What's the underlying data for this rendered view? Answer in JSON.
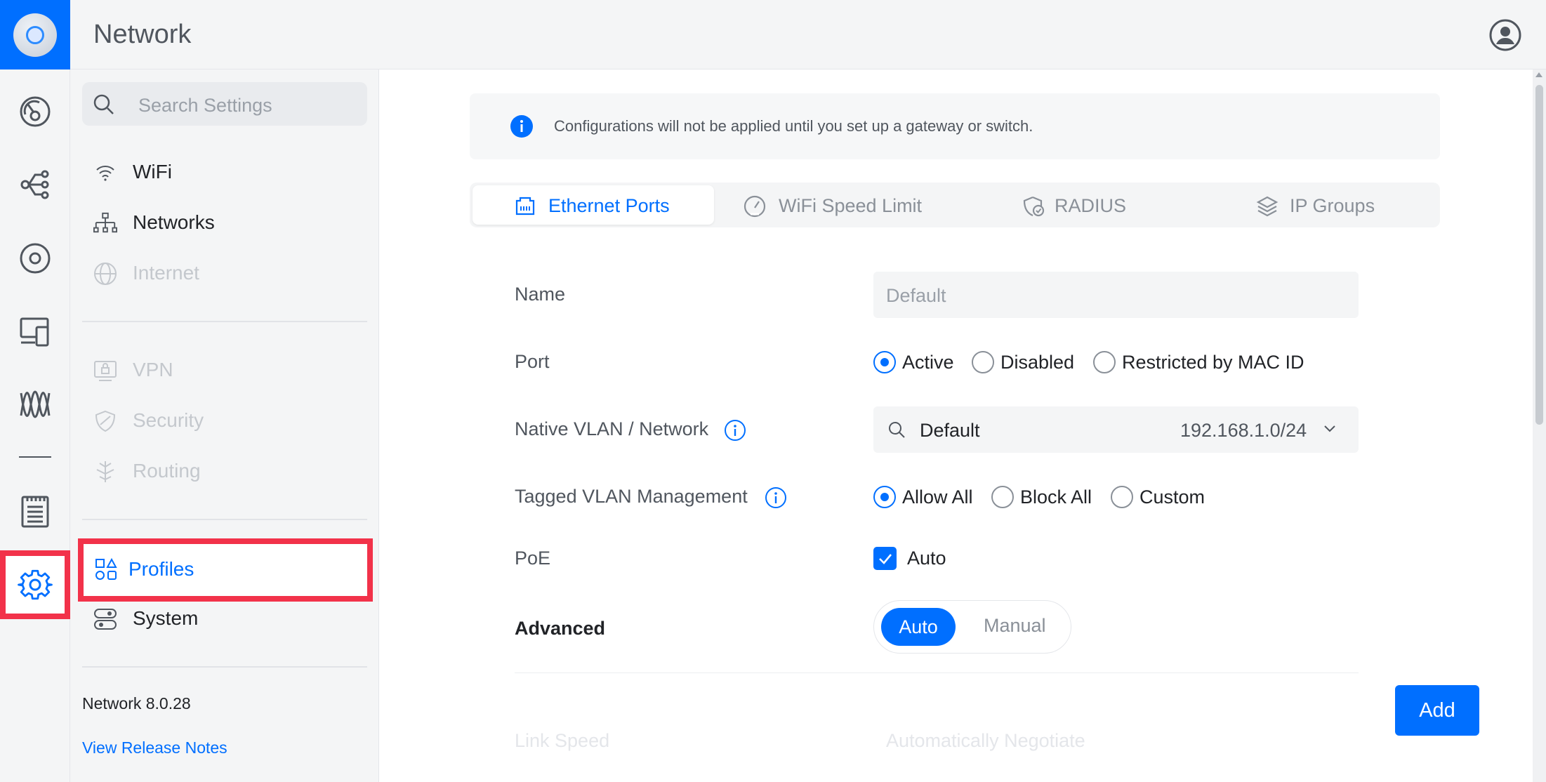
{
  "header": {
    "title": "Network"
  },
  "rail": {
    "items": [
      {
        "name": "dashboard-icon"
      },
      {
        "name": "topology-icon"
      },
      {
        "name": "devices-icon"
      },
      {
        "name": "clients-icon"
      },
      {
        "name": "insights-icon"
      },
      {
        "name": "logs-icon"
      },
      {
        "name": "settings-icon",
        "active": true
      }
    ]
  },
  "nav": {
    "search_placeholder": "Search Settings",
    "items": [
      {
        "label": "WiFi",
        "icon": "wifi-icon",
        "enabled": true
      },
      {
        "label": "Networks",
        "icon": "networks-icon",
        "enabled": true
      },
      {
        "label": "Internet",
        "icon": "globe-icon",
        "enabled": false
      },
      {
        "label": "VPN",
        "icon": "vpn-icon",
        "enabled": false
      },
      {
        "label": "Security",
        "icon": "shield-icon",
        "enabled": false
      },
      {
        "label": "Routing",
        "icon": "routing-icon",
        "enabled": false
      },
      {
        "label": "Profiles",
        "icon": "profiles-icon",
        "enabled": true,
        "active": true
      },
      {
        "label": "System",
        "icon": "system-icon",
        "enabled": true
      }
    ],
    "version": "Network 8.0.28",
    "release_notes": "View Release Notes"
  },
  "banner": {
    "text": "Configurations will not be applied until you set up a gateway or switch."
  },
  "tabs": [
    {
      "label": "Ethernet Ports",
      "icon": "ethernet-icon",
      "active": true
    },
    {
      "label": "WiFi Speed Limit",
      "icon": "speedometer-icon",
      "active": false
    },
    {
      "label": "RADIUS",
      "icon": "radius-icon",
      "active": false
    },
    {
      "label": "IP Groups",
      "icon": "layers-icon",
      "active": false
    }
  ],
  "form": {
    "name": {
      "label": "Name",
      "placeholder": "Default"
    },
    "port": {
      "label": "Port",
      "options": [
        "Active",
        "Disabled",
        "Restricted by MAC ID"
      ],
      "selected": "Active"
    },
    "native_vlan": {
      "label": "Native VLAN / Network",
      "value": "Default",
      "subnet": "192.168.1.0/24"
    },
    "tagged_vlan": {
      "label": "Tagged VLAN Management",
      "options": [
        "Allow All",
        "Block All",
        "Custom"
      ],
      "selected": "Allow All"
    },
    "poe": {
      "label": "PoE",
      "checkbox_label": "Auto",
      "checked": true
    },
    "advanced": {
      "label": "Advanced",
      "options": [
        "Auto",
        "Manual"
      ],
      "selected": "Auto"
    },
    "link_speed": {
      "label": "Link Speed",
      "value": "Automatically Negotiate"
    }
  },
  "actions": {
    "add_label": "Add"
  },
  "colors": {
    "accent": "#006fff",
    "highlight": "#f2324a"
  }
}
